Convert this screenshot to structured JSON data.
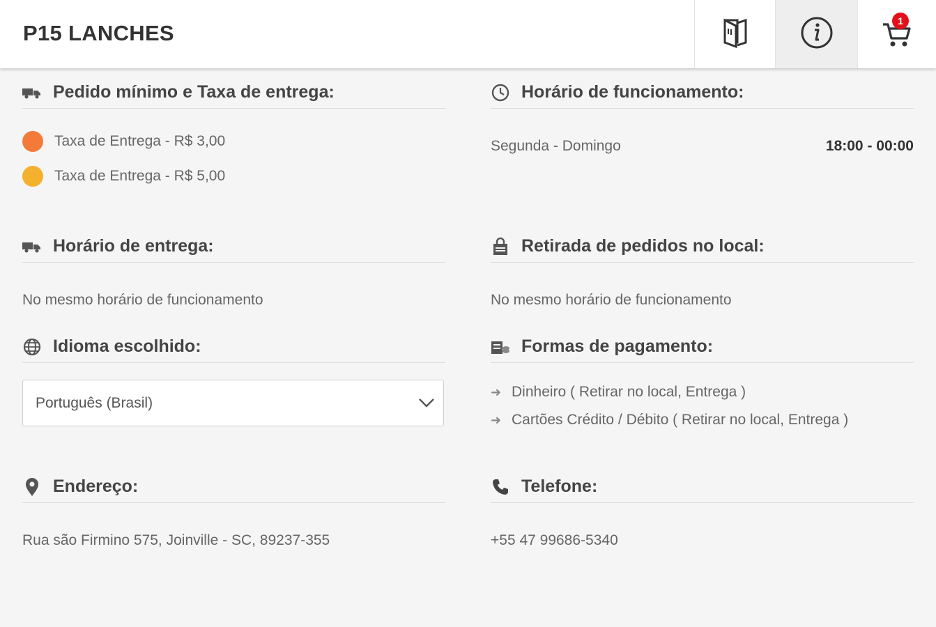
{
  "header": {
    "title": "P15 LANCHES",
    "menu_icon": "menu-book-icon",
    "info_icon": "info-icon",
    "cart_icon": "cart-icon",
    "cart_count": "1"
  },
  "delivery_fee": {
    "title": "Pedido mínimo e Taxa de entrega:",
    "icon": "truck-icon",
    "items": [
      {
        "label": "Taxa de Entrega - R$ 3,00",
        "color": "#f47a3a"
      },
      {
        "label": "Taxa de Entrega - R$ 5,00",
        "color": "#f4b12e"
      }
    ]
  },
  "opening_hours": {
    "title": "Horário de funcionamento:",
    "icon": "clock-icon",
    "days": "Segunda - Domingo",
    "time": "18:00 - 00:00"
  },
  "delivery_hours": {
    "title": "Horário de entrega:",
    "icon": "truck-icon",
    "text": "No mesmo horário de funcionamento"
  },
  "pickup": {
    "title": "Retirada de pedidos no local:",
    "icon": "shopping-bag-icon",
    "text": "No mesmo horário de funcionamento"
  },
  "language": {
    "title": "Idioma escolhido:",
    "icon": "globe-icon",
    "selected": "Português (Brasil)"
  },
  "payment": {
    "title": "Formas de pagamento:",
    "icon": "money-icon",
    "items": [
      "Dinheiro ( Retirar no local, Entrega )",
      "Cartões Crédito / Débito ( Retirar no local, Entrega )"
    ]
  },
  "address": {
    "title": "Endereço:",
    "icon": "map-pin-icon",
    "text": "Rua são Firmino 575, Joinville - SC, 89237-355"
  },
  "phone": {
    "title": "Telefone:",
    "icon": "phone-icon",
    "text": "+55 47 99686-5340"
  },
  "colors": {
    "badge": "#e1111b",
    "fee_1": "#f47a3a",
    "fee_2": "#f4b12e"
  }
}
